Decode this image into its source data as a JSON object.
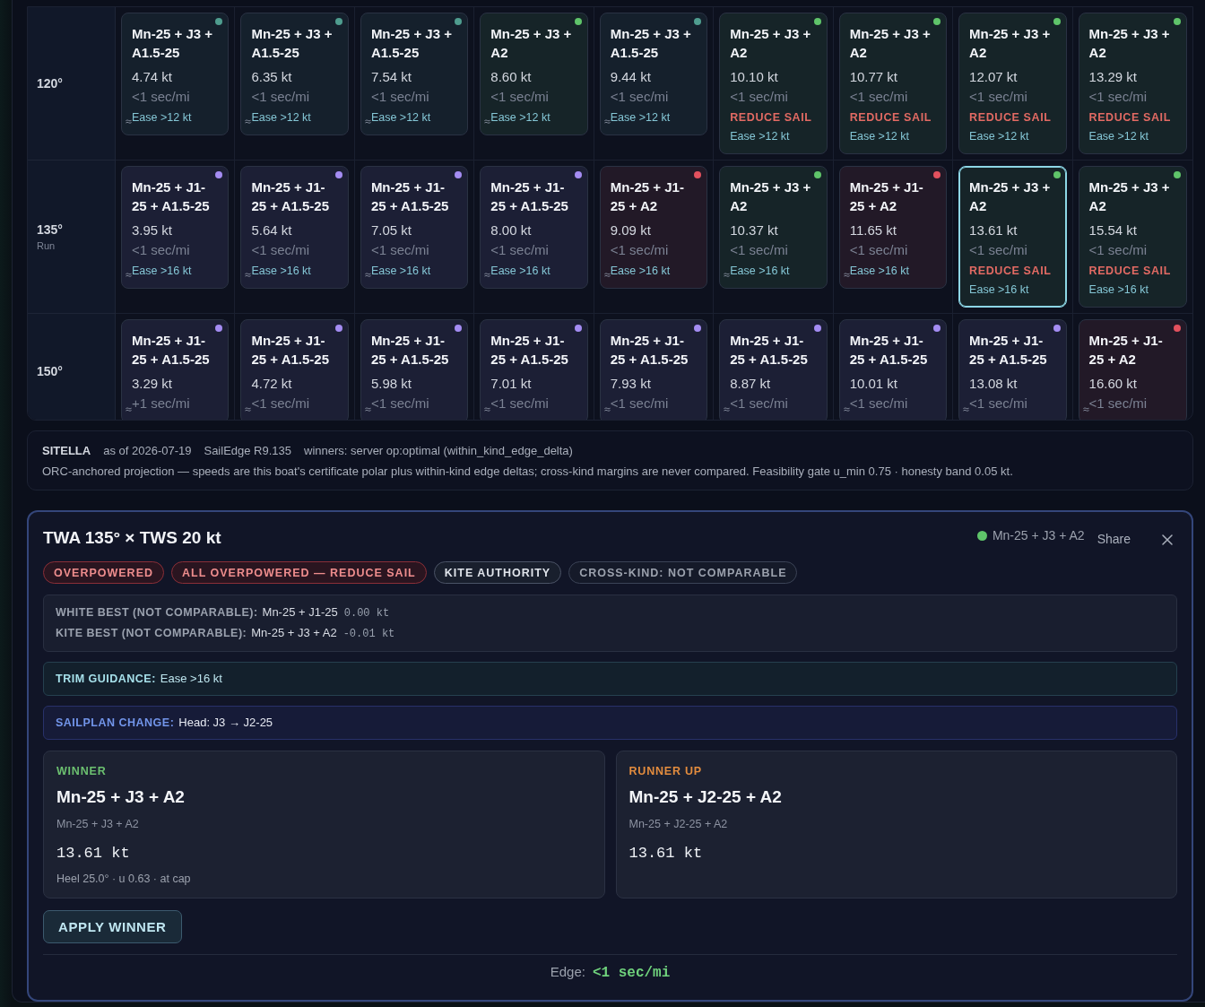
{
  "grid": {
    "rows": [
      {
        "angle": "120°",
        "cells": [
          {
            "sailplan": "Mn-25 + J3 + A1.5-25",
            "speed": "4.74 kt",
            "edge": "<1 sec/mi",
            "trim": "Ease >12 kt",
            "approx": true,
            "color": "#4f9d8f",
            "selected": false
          },
          {
            "sailplan": "Mn-25 + J3 + A1.5-25",
            "speed": "6.35 kt",
            "edge": "<1 sec/mi",
            "trim": "Ease >12 kt",
            "approx": true,
            "color": "#4f9d8f",
            "selected": false
          },
          {
            "sailplan": "Mn-25 + J3 + A1.5-25",
            "speed": "7.54 kt",
            "edge": "<1 sec/mi",
            "trim": "Ease >12 kt",
            "approx": true,
            "color": "#4f9d8f",
            "selected": false
          },
          {
            "sailplan": "Mn-25 + J3 + A2",
            "speed": "8.60 kt",
            "edge": "<1 sec/mi",
            "trim": "Ease >12 kt",
            "approx": true,
            "color": "#5fc46a",
            "selected": false
          },
          {
            "sailplan": "Mn-25 + J3 + A1.5-25",
            "speed": "9.44 kt",
            "edge": "<1 sec/mi",
            "trim": "Ease >12 kt",
            "approx": true,
            "color": "#4f9d8f",
            "selected": false
          },
          {
            "sailplan": "Mn-25 + J3 + A2",
            "speed": "10.10 kt",
            "edge": "<1 sec/mi",
            "alert": "REDUCE SAIL",
            "trim": "Ease >12 kt",
            "approx": false,
            "color": "#5fc46a",
            "selected": false
          },
          {
            "sailplan": "Mn-25 + J3 + A2",
            "speed": "10.77 kt",
            "edge": "<1 sec/mi",
            "alert": "REDUCE SAIL",
            "trim": "Ease >12 kt",
            "approx": false,
            "color": "#5fc46a",
            "selected": false
          },
          {
            "sailplan": "Mn-25 + J3 + A2",
            "speed": "12.07 kt",
            "edge": "<1 sec/mi",
            "alert": "REDUCE SAIL",
            "trim": "Ease >12 kt",
            "approx": false,
            "color": "#5fc46a",
            "selected": false
          },
          {
            "sailplan": "Mn-25 + J3 + A2",
            "speed": "13.29 kt",
            "edge": "<1 sec/mi",
            "alert": "REDUCE SAIL",
            "trim": "Ease >12 kt",
            "approx": false,
            "color": "#5fc46a",
            "selected": false
          }
        ]
      },
      {
        "angle": "135°",
        "note": "Run",
        "cells": [
          {
            "sailplan": "Mn-25 + J1-25 + A1.5-25",
            "speed": "3.95 kt",
            "edge": "<1 sec/mi",
            "trim": "Ease >16 kt",
            "approx": true,
            "color": "#a48cf2",
            "selected": false
          },
          {
            "sailplan": "Mn-25 + J1-25 + A1.5-25",
            "speed": "5.64 kt",
            "edge": "<1 sec/mi",
            "trim": "Ease >16 kt",
            "approx": true,
            "color": "#a48cf2",
            "selected": false
          },
          {
            "sailplan": "Mn-25 + J1-25 + A1.5-25",
            "speed": "7.05 kt",
            "edge": "<1 sec/mi",
            "trim": "Ease >16 kt",
            "approx": true,
            "color": "#a48cf2",
            "selected": false
          },
          {
            "sailplan": "Mn-25 + J1-25 + A1.5-25",
            "speed": "8.00 kt",
            "edge": "<1 sec/mi",
            "trim": "Ease >16 kt",
            "approx": true,
            "color": "#a48cf2",
            "selected": false
          },
          {
            "sailplan": "Mn-25 + J1-25 + A2",
            "speed": "9.09 kt",
            "edge": "<1 sec/mi",
            "trim": "Ease >16 kt",
            "approx": true,
            "color": "#e2515e",
            "selected": false
          },
          {
            "sailplan": "Mn-25 + J3 + A2",
            "speed": "10.37 kt",
            "edge": "<1 sec/mi",
            "trim": "Ease >16 kt",
            "approx": true,
            "color": "#5fc46a",
            "selected": false
          },
          {
            "sailplan": "Mn-25 + J1-25 + A2",
            "speed": "11.65 kt",
            "edge": "<1 sec/mi",
            "trim": "Ease >16 kt",
            "approx": true,
            "color": "#e2515e",
            "selected": false
          },
          {
            "sailplan": "Mn-25 + J3 + A2",
            "speed": "13.61 kt",
            "edge": "<1 sec/mi",
            "alert": "REDUCE SAIL",
            "trim": "Ease >16 kt",
            "approx": false,
            "color": "#5fc46a",
            "selected": true
          },
          {
            "sailplan": "Mn-25 + J3 + A2",
            "speed": "15.54 kt",
            "edge": "<1 sec/mi",
            "alert": "REDUCE SAIL",
            "trim": "Ease >16 kt",
            "approx": false,
            "color": "#5fc46a",
            "selected": false
          }
        ]
      },
      {
        "angle": "150°",
        "cells": [
          {
            "sailplan": "Mn-25 + J1-25 + A1.5-25",
            "speed": "3.29 kt",
            "edge": "+1 sec/mi",
            "approx": true,
            "color": "#a48cf2",
            "selected": false
          },
          {
            "sailplan": "Mn-25 + J1-25 + A1.5-25",
            "speed": "4.72 kt",
            "edge": "<1 sec/mi",
            "approx": true,
            "color": "#a48cf2",
            "selected": false
          },
          {
            "sailplan": "Mn-25 + J1-25 + A1.5-25",
            "speed": "5.98 kt",
            "edge": "<1 sec/mi",
            "approx": true,
            "color": "#a48cf2",
            "selected": false
          },
          {
            "sailplan": "Mn-25 + J1-25 + A1.5-25",
            "speed": "7.01 kt",
            "edge": "<1 sec/mi",
            "approx": true,
            "color": "#a48cf2",
            "selected": false
          },
          {
            "sailplan": "Mn-25 + J1-25 + A1.5-25",
            "speed": "7.93 kt",
            "edge": "<1 sec/mi",
            "approx": true,
            "color": "#a48cf2",
            "selected": false
          },
          {
            "sailplan": "Mn-25 + J1-25 + A1.5-25",
            "speed": "8.87 kt",
            "edge": "<1 sec/mi",
            "approx": true,
            "color": "#a48cf2",
            "selected": false
          },
          {
            "sailplan": "Mn-25 + J1-25 + A1.5-25",
            "speed": "10.01 kt",
            "edge": "<1 sec/mi",
            "approx": true,
            "color": "#a48cf2",
            "selected": false
          },
          {
            "sailplan": "Mn-25 + J1-25 + A1.5-25",
            "speed": "13.08 kt",
            "edge": "<1 sec/mi",
            "approx": true,
            "color": "#a48cf2",
            "selected": false
          },
          {
            "sailplan": "Mn-25 + J1-25 + A2",
            "speed": "16.60 kt",
            "edge": "<1 sec/mi",
            "approx": true,
            "color": "#e2515e",
            "selected": false
          }
        ]
      }
    ]
  },
  "info": {
    "boat": "SITELLA",
    "date": "as of 2026-07-19",
    "version": "SailEdge R9.135",
    "winners": "winners: server op:optimal (within_kind_edge_delta)",
    "note": "ORC-anchored projection — speeds are this boat's certificate polar plus within-kind edge deltas; cross-kind margins are never compared. Feasibility gate u_min 0.75 · honesty band 0.05 kt."
  },
  "detail": {
    "title": "TWA 135° × TWS 20 kt",
    "current": {
      "label": "Mn-25 + J3 + A2",
      "color": "#5fc46a"
    },
    "share": "Share",
    "badges": [
      {
        "label": "OVERPOWERED",
        "kind": "danger"
      },
      {
        "label": "ALL OVERPOWERED — REDUCE SAIL",
        "kind": "danger"
      },
      {
        "label": "KITE AUTHORITY",
        "kind": "strong"
      },
      {
        "label": "CROSS-KIND: NOT COMPARABLE",
        "kind": "muted"
      }
    ],
    "comparison": [
      {
        "label": "WHITE BEST (NOT COMPARABLE):",
        "sailplan": "Mn-25 + J1-25",
        "delta": "0.00 kt"
      },
      {
        "label": "KITE BEST (NOT COMPARABLE):",
        "sailplan": "Mn-25 + J3 + A2",
        "delta": "-0.01 kt"
      }
    ],
    "notices": [
      {
        "kind": "trim",
        "label": "TRIM GUIDANCE:",
        "text": "Ease >16 kt"
      },
      {
        "kind": "sailplan",
        "label": "SAILPLAN CHANGE:",
        "text": "Head: J3 → J2-25"
      }
    ],
    "candidates": [
      {
        "kind": "winner",
        "role": "WINNER",
        "name": "Mn-25 + J3 + A2",
        "detail": "Mn-25 + J3 + A2",
        "speed": "13.61 kt",
        "note": "Heel 25.0° · u 0.63 · at cap"
      },
      {
        "kind": "runner_up",
        "role": "RUNNER UP",
        "name": "Mn-25 + J2-25 + A2",
        "detail": "Mn-25 + J2-25 + A2",
        "speed": "13.61 kt"
      }
    ],
    "apply": "APPLY WINNER",
    "edge": {
      "label": "Edge:",
      "value": "<1 sec/mi"
    }
  }
}
